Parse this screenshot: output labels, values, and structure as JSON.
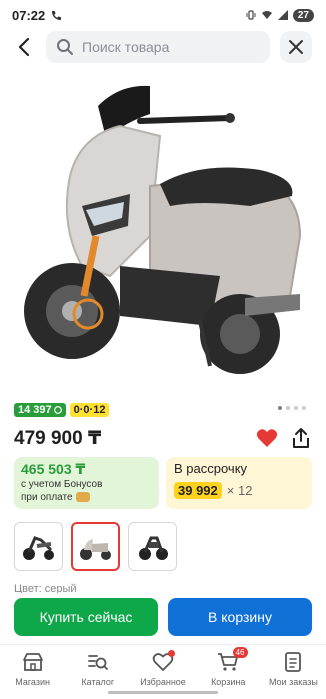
{
  "status_bar": {
    "time": "07:22",
    "battery": "27"
  },
  "search": {
    "placeholder": "Поиск товара"
  },
  "badges": {
    "points": "14 397",
    "installment": "0·0·12"
  },
  "price": "479 900 ₸",
  "bonus_card": {
    "amount": "465 503 ₸",
    "line1": "с учетом Бонусов",
    "line2": "при оплате"
  },
  "installment_card": {
    "title": "В рассрочку",
    "monthly": "39 992",
    "months": "× 12"
  },
  "gallery": {
    "dots_total": 4,
    "active_dot": 1,
    "selected_thumb": 2
  },
  "color_label": "Цвет: серый",
  "actions": {
    "buy_now": "Купить сейчас",
    "add_to_cart": "В корзину"
  },
  "nav": {
    "items": [
      {
        "label": "Магазин",
        "icon": "store-icon"
      },
      {
        "label": "Каталог",
        "icon": "catalog-icon"
      },
      {
        "label": "Избранное",
        "icon": "heart-icon"
      },
      {
        "label": "Корзина",
        "icon": "cart-icon",
        "count": "46"
      },
      {
        "label": "Мои заказы",
        "icon": "orders-icon"
      }
    ]
  },
  "colors": {
    "green": "#0ea84a",
    "blue": "#0f71d6",
    "red": "#e53935",
    "yellow": "#ffd21f"
  }
}
